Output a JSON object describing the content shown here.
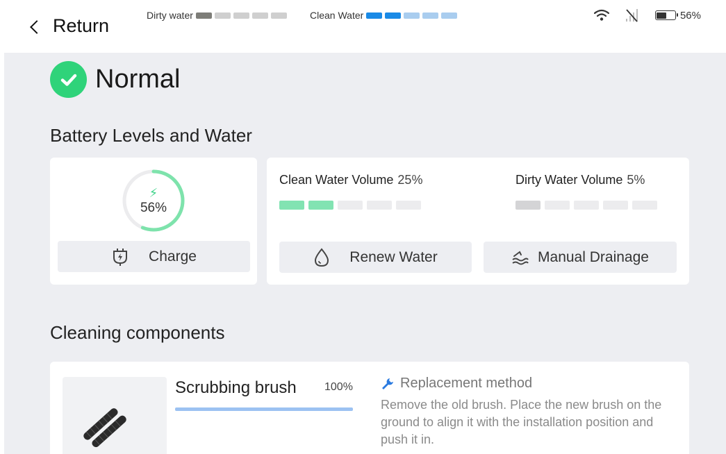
{
  "header": {
    "return_label": "Return",
    "dirty_water_label": "Dirty water",
    "dirty_water_segments": [
      "#7d7d78",
      "#cfcfcf",
      "#cfcfcf",
      "#cfcfcf",
      "#cfcfcf"
    ],
    "clean_water_label": "Clean Water",
    "clean_water_segments": [
      "#1a8ae6",
      "#1a8ae6",
      "#a9cdef",
      "#a9cdef",
      "#a9cdef"
    ],
    "battery_percent": "56%",
    "battery_level": 0.56,
    "icons": [
      "wifi-icon",
      "no-signal-icon",
      "battery-icon"
    ]
  },
  "status": {
    "label": "Normal",
    "color": "#2fd37a"
  },
  "battery_water": {
    "section_title": "Battery Levels and Water",
    "battery_percent": "56%",
    "battery_fraction": 0.56,
    "charge_label": "Charge",
    "clean_water_label": "Clean Water Volume",
    "clean_water_value": "25%",
    "clean_water_segments": [
      "#82e3b2",
      "#82e3b2",
      "#ececee",
      "#ececee",
      "#ececee"
    ],
    "dirty_water_label": "Dirty Water Volume",
    "dirty_water_value": "5%",
    "dirty_water_segments": [
      "#d4d4d6",
      "#ececee",
      "#ececee",
      "#ececee",
      "#ececee"
    ],
    "renew_water_label": "Renew Water",
    "manual_drainage_label": "Manual Drainage"
  },
  "components": {
    "section_title": "Cleaning components",
    "item": {
      "name": "Scrubbing brush",
      "percent": "100%",
      "fraction": 1.0,
      "replacement_title": "Replacement method",
      "replacement_desc": "Remove the old brush. Place the new brush on the ground to align it with the installation position and push it in."
    }
  }
}
